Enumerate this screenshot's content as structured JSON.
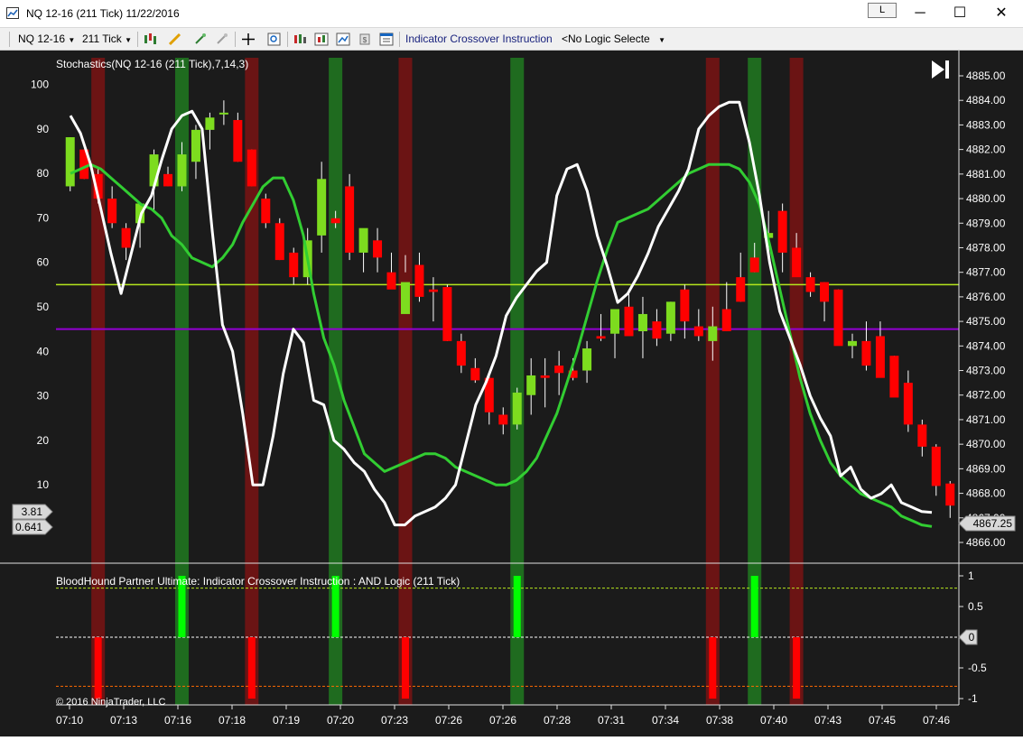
{
  "window": {
    "title": "NQ 12-16 (211 Tick)  11/22/2016",
    "l_button": "L",
    "minimize": "─",
    "maximize": "☐",
    "close": "✕"
  },
  "toolbar": {
    "instrument": "NQ 12-16",
    "interval": "211 Tick",
    "indicator_label": "Indicator Crossover Instruction",
    "logic_select": "<No Logic Selecte"
  },
  "colors": {
    "background": "#1b1b1b",
    "up_candle": "#7ddc1f",
    "down_candle": "#ff0000",
    "stoch_k": "#ffffff",
    "stoch_d": "#32cd32",
    "upper_level": "#b5e61d",
    "lower_level": "#9400d3",
    "highlight_green": "#1f6b1f",
    "highlight_red": "#6b1414",
    "bar_green": "#00ff00",
    "bar_red": "#ff0000"
  },
  "main_panel": {
    "indicator_title": "Stochastics(NQ 12-16 (211 Tick),7,14,3)",
    "k_value_tag": "3.81",
    "d_value_tag": "0.641",
    "last_price_tag": "4867.25",
    "play_icon": "skip-to-end-icon"
  },
  "lower_panel": {
    "title": "BloodHound Partner Ultimate: Indicator Crossover Instruction : AND Logic (211 Tick)",
    "copyright": "© 2016 NinjaTrader, LLC",
    "zero_tag": "0"
  },
  "chart_data": [
    {
      "type": "candlestick",
      "title": "NQ 12-16 (211 Tick)",
      "ylim": [
        4866.0,
        4885.0
      ],
      "price_ticks": [
        "4866.00",
        "4867.00",
        "4868.00",
        "4869.00",
        "4870.00",
        "4871.00",
        "4872.00",
        "4873.00",
        "4874.00",
        "4875.00",
        "4876.00",
        "4877.00",
        "4878.00",
        "4879.00",
        "4880.00",
        "4881.00",
        "4882.00",
        "4883.00",
        "4884.00",
        "4885.00"
      ],
      "time_labels": [
        "07:10",
        "07:13",
        "07:16",
        "07:18",
        "07:19",
        "07:20",
        "07:23",
        "07:26",
        "07:26",
        "07:28",
        "07:31",
        "07:34",
        "07:38",
        "07:40",
        "07:43",
        "07:45",
        "07:46"
      ],
      "ohlc": [
        [
          4880.5,
          4882.5,
          4880.3,
          4882.5
        ],
        [
          4882.0,
          4882.0,
          4880.8,
          4880.8
        ],
        [
          4881.0,
          4881.3,
          4879.8,
          4880.0
        ],
        [
          4880.0,
          4880.5,
          4878.8,
          4879.0
        ],
        [
          4878.8,
          4879.0,
          4877.5,
          4878.0
        ],
        [
          4879.0,
          4879.8,
          4878.0,
          4879.8
        ],
        [
          4880.5,
          4882.0,
          4879.5,
          4881.8
        ],
        [
          4881.0,
          4881.3,
          4880.5,
          4880.5
        ],
        [
          4880.5,
          4882.3,
          4880.3,
          4881.8
        ],
        [
          4881.5,
          4883.0,
          4880.8,
          4882.8
        ],
        [
          4882.8,
          4883.5,
          4882.0,
          4883.3
        ],
        [
          4883.5,
          4884.0,
          4883.0,
          4883.5
        ],
        [
          4883.2,
          4883.5,
          4881.5,
          4881.5
        ],
        [
          4882.0,
          4882.0,
          4880.5,
          4880.5
        ],
        [
          4880.0,
          4880.2,
          4878.8,
          4879.0
        ],
        [
          4879.0,
          4879.2,
          4877.5,
          4877.5
        ],
        [
          4877.8,
          4878.0,
          4876.5,
          4876.8
        ],
        [
          4876.8,
          4878.8,
          4876.5,
          4878.3
        ],
        [
          4878.5,
          4881.5,
          4877.8,
          4880.8
        ],
        [
          4879.2,
          4879.5,
          4878.8,
          4879.0
        ],
        [
          4880.5,
          4881.0,
          4877.5,
          4877.8
        ],
        [
          4877.8,
          4878.5,
          4877.0,
          4878.8
        ],
        [
          4878.3,
          4878.8,
          4877.0,
          4877.6
        ],
        [
          4877.0,
          4877.8,
          4876.5,
          4876.3
        ],
        [
          4875.3,
          4877.7,
          4877.0,
          4876.6
        ],
        [
          4877.3,
          4877.8,
          4875.8,
          4876.0
        ],
        [
          4876.3,
          4876.8,
          4875.0,
          4876.2
        ],
        [
          4876.4,
          4876.5,
          4874.2,
          4874.2
        ],
        [
          4874.2,
          4874.5,
          4872.9,
          4873.2
        ],
        [
          4873.1,
          4873.5,
          4872.5,
          4872.6
        ],
        [
          4872.7,
          4872.8,
          4870.8,
          4871.3
        ],
        [
          4871.2,
          4871.5,
          4870.4,
          4870.8
        ],
        [
          4870.8,
          4872.3,
          4870.6,
          4872.1
        ],
        [
          4872.0,
          4873.5,
          4871.2,
          4872.8
        ],
        [
          4872.8,
          4873.5,
          4871.5,
          4872.7
        ],
        [
          4873.2,
          4873.8,
          4872.0,
          4872.9
        ],
        [
          4873.0,
          4873.5,
          4872.6,
          4872.7
        ],
        [
          4873.0,
          4874.2,
          4872.5,
          4873.9
        ],
        [
          4874.4,
          4875.3,
          4874.2,
          4874.3
        ],
        [
          4874.5,
          4875.5,
          4873.5,
          4875.5
        ],
        [
          4875.6,
          4876.2,
          4874.5,
          4874.4
        ],
        [
          4874.6,
          4876.0,
          4873.5,
          4875.3
        ],
        [
          4875.0,
          4875.5,
          4874.0,
          4874.3
        ],
        [
          4874.5,
          4875.8,
          4874.2,
          4875.8
        ],
        [
          4876.3,
          4876.5,
          4874.3,
          4875.0
        ],
        [
          4874.8,
          4875.5,
          4874.2,
          4874.4
        ],
        [
          4874.2,
          4875.6,
          4873.4,
          4874.8
        ],
        [
          4875.5,
          4876.6,
          4874.6,
          4874.6
        ],
        [
          4876.8,
          4877.8,
          4875.8,
          4875.8
        ],
        [
          4877.6,
          4878.2,
          4877.0,
          4877.0
        ],
        [
          4878.4,
          4879.5,
          4877.8,
          4878.6
        ],
        [
          4879.5,
          4879.8,
          4877.0,
          4877.8
        ],
        [
          4878.0,
          4878.6,
          4877.0,
          4876.8
        ],
        [
          4876.8,
          4877.0,
          4876.0,
          4876.2
        ],
        [
          4876.6,
          4876.6,
          4875.0,
          4875.8
        ],
        [
          4876.3,
          4876.3,
          4874.2,
          4874.0
        ],
        [
          4874.0,
          4874.5,
          4873.5,
          4874.2
        ],
        [
          4874.2,
          4875.0,
          4873.0,
          4873.2
        ],
        [
          4874.4,
          4875.0,
          4873.5,
          4872.7
        ],
        [
          4873.6,
          4873.6,
          4872.0,
          4871.9
        ],
        [
          4872.5,
          4873.0,
          4870.5,
          4870.8
        ],
        [
          4870.8,
          4871.0,
          4869.5,
          4869.9
        ],
        [
          4869.9,
          4870.0,
          4867.9,
          4868.3
        ],
        [
          4868.4,
          4868.5,
          4867.0,
          4867.5
        ]
      ]
    },
    {
      "type": "line",
      "title": "Stochastics(NQ 12-16 (211 Tick),7,14,3)",
      "ylim": [
        -7,
        106
      ],
      "y_ticks": [
        10,
        20,
        30,
        40,
        50,
        60,
        70,
        80,
        90,
        100
      ],
      "series": [
        {
          "role": "K",
          "values": [
            93,
            89,
            82,
            72,
            62,
            53,
            62,
            71,
            75,
            83,
            90,
            93,
            94,
            90,
            67,
            46,
            40,
            26,
            10,
            10,
            21,
            35,
            45,
            42,
            29,
            28,
            20,
            18,
            15,
            13,
            9,
            6,
            1,
            1,
            3,
            4,
            5,
            7,
            10,
            19,
            28,
            33,
            39,
            48,
            52,
            55,
            58,
            60,
            75,
            81,
            82,
            76,
            66,
            59,
            51,
            53,
            57,
            62,
            68,
            72,
            76,
            81,
            90,
            93,
            95,
            96,
            96,
            87,
            75,
            60,
            49,
            43,
            37,
            30,
            25,
            21,
            12,
            14,
            9,
            7,
            8,
            10,
            6,
            5,
            4,
            3.81
          ]
        },
        {
          "role": "D",
          "values": [
            80,
            81,
            82,
            81,
            79,
            77,
            75,
            73,
            72,
            70,
            66,
            64,
            61,
            60,
            59,
            61,
            64,
            69,
            73,
            77,
            79,
            79,
            74,
            66,
            53,
            43,
            37,
            29,
            23,
            17,
            15,
            13,
            14,
            15,
            16,
            17,
            17,
            16,
            14,
            13,
            12,
            11,
            10,
            10,
            11,
            13,
            16,
            21,
            26,
            33,
            40,
            48,
            56,
            63,
            69,
            70,
            71,
            72,
            74,
            76,
            78,
            80,
            81,
            82,
            82,
            82,
            81,
            78,
            73,
            64,
            54,
            44,
            34,
            26,
            20,
            15,
            12,
            10,
            8,
            7,
            6,
            5,
            3,
            2,
            1,
            0.641
          ]
        }
      ],
      "levels": [
        55,
        45
      ]
    },
    {
      "type": "bar",
      "title": "BloodHound Partner Ultimate: Indicator Crossover Instruction : AND Logic (211 Tick)",
      "ylim": [
        -1,
        1
      ],
      "y_ticks": [
        "1",
        "0.5",
        "0",
        "-0.5",
        "-1"
      ],
      "signals": [
        {
          "bar": 2,
          "value": -1
        },
        {
          "bar": 8,
          "value": 1
        },
        {
          "bar": 13,
          "value": -1
        },
        {
          "bar": 19,
          "value": 1
        },
        {
          "bar": 24,
          "value": -1
        },
        {
          "bar": 32,
          "value": 1
        },
        {
          "bar": 46,
          "value": -1
        },
        {
          "bar": 49,
          "value": 1
        },
        {
          "bar": 52,
          "value": -1
        }
      ],
      "dashed_levels": [
        0.8,
        0,
        -0.8
      ]
    }
  ]
}
